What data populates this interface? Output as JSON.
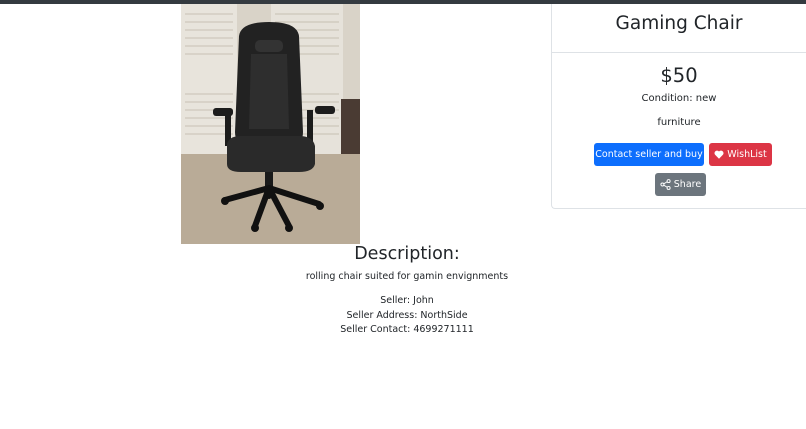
{
  "product": {
    "title": "Gaming Chair",
    "price": "$50",
    "condition": "Condition: new",
    "category": "furniture",
    "image_alt": "Black gaming chair"
  },
  "actions": {
    "buy_label": "Contact seller and buy",
    "wishlist_label": "WishList",
    "share_label": "Share"
  },
  "description": {
    "heading": "Description:",
    "text": "rolling chair suited for gamin envignments"
  },
  "seller": {
    "name": "Seller: John",
    "address": "Seller Address: NorthSide",
    "contact": "Seller Contact: 4699271111"
  },
  "icons": {
    "wishlist": "heart-icon",
    "share": "share-icon"
  },
  "colors": {
    "primary": "#0d6efd",
    "danger": "#dc3545",
    "secondary": "#6c757d",
    "topbar": "#343a40"
  }
}
